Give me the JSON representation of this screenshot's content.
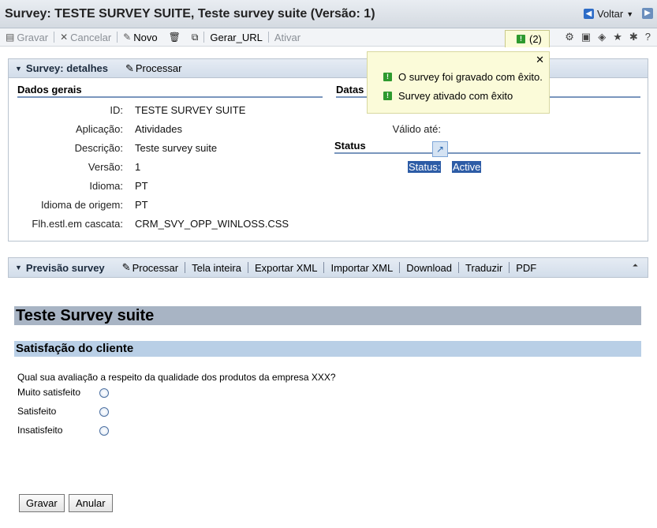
{
  "window": {
    "title": "Survey: TESTE SURVEY SUITE, Teste survey suite (Versão: 1)",
    "back_label": "Voltar"
  },
  "toolbar": {
    "save": "Gravar",
    "cancel": "Cancelar",
    "new": "Novo",
    "generate_url": "Gerar_URL",
    "activate": "Ativar"
  },
  "messages": {
    "count": "(2)",
    "items": [
      "O survey foi gravado com êxito.",
      "Survey ativado com êxito"
    ]
  },
  "details_panel": {
    "title": "Survey: detalhes",
    "edit_link": "Processar",
    "general_header": "Dados gerais",
    "dates_header": "Datas",
    "status_header": "Status",
    "fields": [
      {
        "label": "ID:",
        "value": "TESTE SURVEY SUITE"
      },
      {
        "label": "Aplicação:",
        "value": "Atividades"
      },
      {
        "label": "Descrição:",
        "value": "Teste survey suite"
      },
      {
        "label": "Versão:",
        "value": "1"
      },
      {
        "label": "Idioma:",
        "value": "PT"
      },
      {
        "label": "Idioma de origem:",
        "value": "PT"
      },
      {
        "label": "Flh.estl.em cascata:",
        "value": "CRM_SVY_OPP_WINLOSS.CSS"
      }
    ],
    "valid_to_label": "Válido até:",
    "status_label": "Status:",
    "status_value": "Active"
  },
  "preview_panel": {
    "title": "Previsão survey",
    "links": [
      "Processar",
      "Tela inteira",
      "Exportar XML",
      "Importar XML",
      "Download",
      "Traduzir",
      "PDF"
    ]
  },
  "survey": {
    "title": "Teste Survey suite",
    "section": "Satisfação do cliente",
    "question": "Qual sua avaliação a respeito da qualidade dos produtos da empresa XXX?",
    "options": [
      "Muito satisfeito",
      "Satisfeito",
      "Insatisfeito"
    ],
    "save_button": "Gravar",
    "cancel_button": "Anular"
  }
}
